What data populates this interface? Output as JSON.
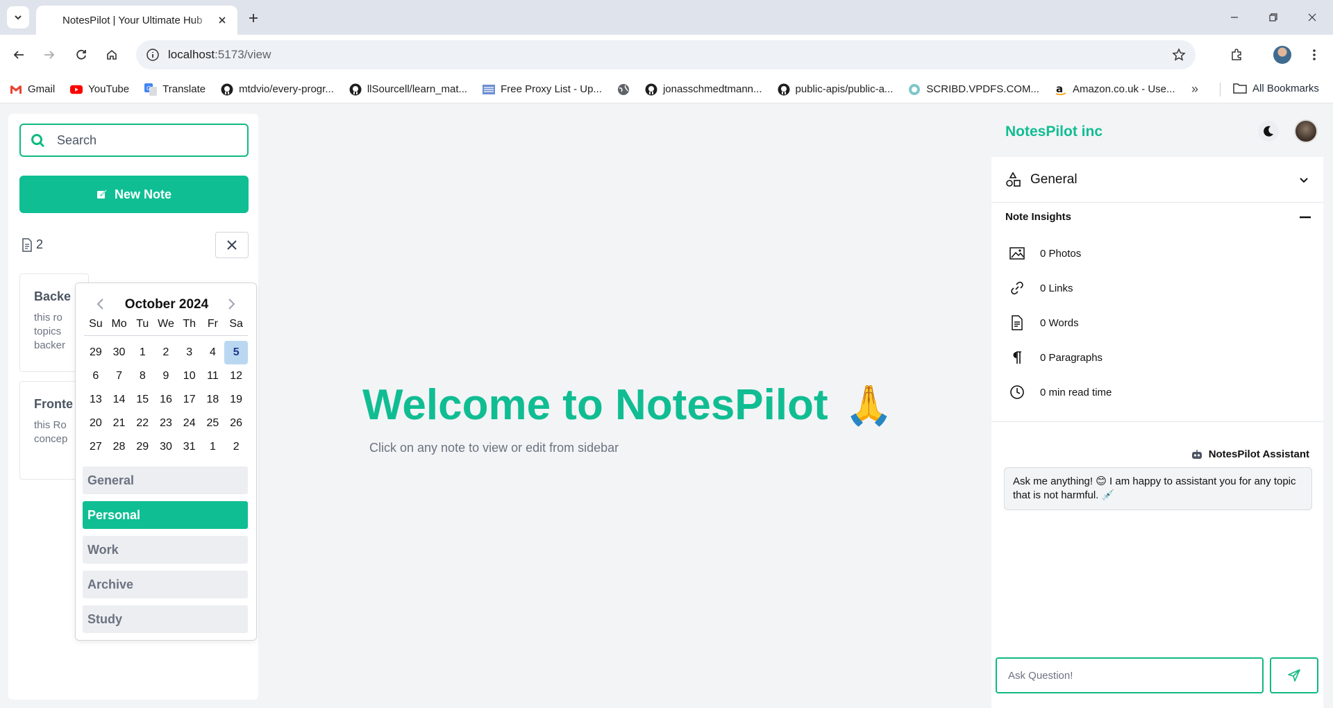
{
  "browser": {
    "tab_title": "NotesPilot | Your Ultimate Hub",
    "url_host": "localhost",
    "url_path": ":5173/view",
    "bookmarks": [
      {
        "label": "Gmail",
        "icon": "gmail-icon"
      },
      {
        "label": "YouTube",
        "icon": "youtube-icon"
      },
      {
        "label": "Translate",
        "icon": "translate-icon"
      },
      {
        "label": "mtdvio/every-progr...",
        "icon": "github-icon"
      },
      {
        "label": "llSourcell/learn_mat...",
        "icon": "github-icon"
      },
      {
        "label": "Free Proxy List - Up...",
        "icon": "proxy-list-icon"
      },
      {
        "label": "",
        "icon": "globe-icon"
      },
      {
        "label": "jonasschmedtmann...",
        "icon": "github-icon"
      },
      {
        "label": "public-apis/public-a...",
        "icon": "github-icon"
      },
      {
        "label": "SCRIBD.VPDFS.COM...",
        "icon": "scribd-icon"
      },
      {
        "label": "Amazon.co.uk - Use...",
        "icon": "amazon-icon"
      }
    ],
    "all_bookmarks": "All Bookmarks"
  },
  "sidebar": {
    "search_placeholder": "Search",
    "new_note_label": "New Note",
    "note_count": "2",
    "notes": [
      {
        "title": "Backe",
        "desc_lines": [
          "this ro",
          "topics",
          "backer"
        ]
      },
      {
        "title": "Fronte",
        "desc_lines": [
          "this Ro",
          "concep"
        ]
      }
    ]
  },
  "calendar": {
    "month_label": "October 2024",
    "weekdays": [
      "Su",
      "Mo",
      "Tu",
      "We",
      "Th",
      "Fr",
      "Sa"
    ],
    "days": [
      "29",
      "30",
      "1",
      "2",
      "3",
      "4",
      "5",
      "6",
      "7",
      "8",
      "9",
      "10",
      "11",
      "12",
      "13",
      "14",
      "15",
      "16",
      "17",
      "18",
      "19",
      "20",
      "21",
      "22",
      "23",
      "24",
      "25",
      "26",
      "27",
      "28",
      "29",
      "30",
      "31",
      "1",
      "2"
    ],
    "selected_index": 6,
    "categories": [
      {
        "label": "General",
        "active": false
      },
      {
        "label": "Personal",
        "active": true
      },
      {
        "label": "Work",
        "active": false
      },
      {
        "label": "Archive",
        "active": false
      },
      {
        "label": "Study",
        "active": false
      }
    ]
  },
  "main": {
    "welcome_title": "Welcome to NotesPilot",
    "welcome_emoji": "🙏",
    "welcome_subtitle": "Click on any note to view or edit from sidebar"
  },
  "right_panel": {
    "brand": "NotesPilot inc",
    "category_select": "General",
    "insights_title": "Note Insights",
    "insights": [
      {
        "label": "0 Photos",
        "icon": "image-icon"
      },
      {
        "label": "0 Links",
        "icon": "link-icon"
      },
      {
        "label": "0 Words",
        "icon": "document-icon"
      },
      {
        "label": "0 Paragraphs",
        "icon": "paragraph-icon"
      },
      {
        "label": "0 min read time",
        "icon": "clock-icon"
      }
    ],
    "assistant_name": "NotesPilot Assistant",
    "assistant_message": "Ask me anything! 😊 I am happy to assistant you for any topic that is not harmful. 💉",
    "ask_placeholder": "Ask Question!"
  },
  "colors": {
    "accent": "#10bd92",
    "button": "#0fbf93",
    "selected_day": "#b9d7f1"
  }
}
